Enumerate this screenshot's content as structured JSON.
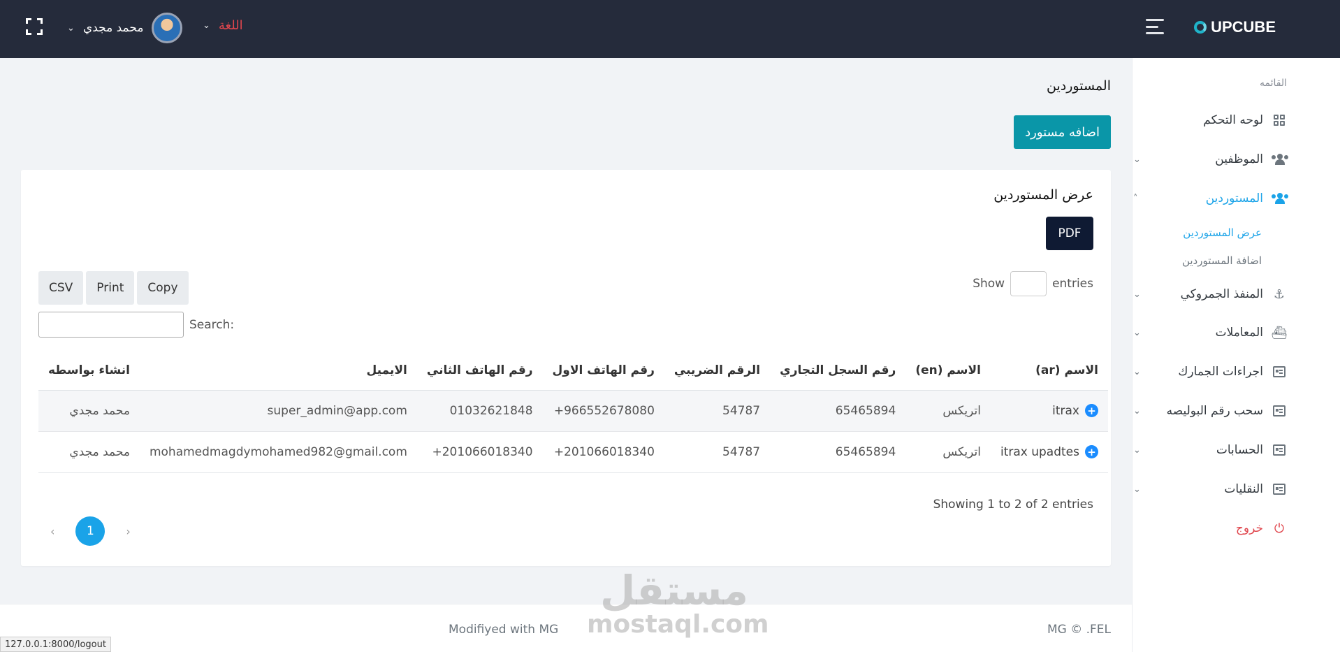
{
  "header": {
    "brand": "UPCUBE",
    "language_label": "اللغة",
    "user_name": "محمد مجدي"
  },
  "sidebar": {
    "section_title": "القائمه",
    "items": [
      {
        "label": "لوحه التحكم",
        "icon": "dashboard-icon"
      },
      {
        "label": "الموظفين",
        "icon": "users-icon"
      },
      {
        "label": "المستوردين",
        "icon": "users-icon"
      },
      {
        "label": "المنفذ الجمروكي",
        "icon": "anchor-icon"
      },
      {
        "label": "المعاملات",
        "icon": "ship-icon"
      },
      {
        "label": "اجراءات الجمارك",
        "icon": "list-box-icon"
      },
      {
        "label": "سحب رقم البوليصه",
        "icon": "list-box-icon"
      },
      {
        "label": "الحسابات",
        "icon": "list-box-icon"
      },
      {
        "label": "النقليات",
        "icon": "list-box-icon"
      },
      {
        "label": "خروج",
        "icon": "power-icon"
      }
    ],
    "subitems": [
      {
        "label": "عرض المستوردين"
      },
      {
        "label": "اضافة المستوردين"
      }
    ]
  },
  "main": {
    "page_title": "المستوردين",
    "add_button": "اضافه مستورد",
    "card_title": "عرض المستوردين",
    "pdf_button": "PDF",
    "show_label": "Show",
    "entries_label": "entries",
    "export_buttons": [
      "Copy",
      "Print",
      "CSV"
    ],
    "search_label": "Search:",
    "table": {
      "headers": [
        "الاسم (ar)",
        "الاسم (en)",
        "رقم السجل التجاري",
        "الرقم الضريبي",
        "رقم الهاتف الاول",
        "رقم الهاتف الثاني",
        "الايميل",
        "انشاء بواسطه"
      ],
      "rows": [
        [
          "itrax",
          "اتريكس",
          "65465894",
          "54787",
          "+966552678080",
          "01032621848",
          "super_admin@app.com",
          "محمد مجدي"
        ],
        [
          "itrax upadtes",
          "اتريكس",
          "65465894",
          "54787",
          "+201066018340",
          "+201066018340",
          "mohamedmagdymohamed982@gmail.com",
          "محمد مجدي"
        ]
      ]
    },
    "info": "Showing 1 to 2 of 2 entries",
    "pagination": {
      "prev": "‹",
      "current": "1",
      "next": "›"
    }
  },
  "footer": {
    "left": "Modifiyed with MG",
    "right": "MG © .FEL"
  },
  "watermark": {
    "arabic": "مستقل",
    "latin": "mostaql.com"
  },
  "status_url": "127.0.0.1:8000/logout",
  "colors": {
    "topbar": "#252b3b",
    "accent": "#1aa3e8",
    "add_button": "#0a96a8",
    "pdf_button": "#0f1a33",
    "danger": "#e0464d"
  }
}
